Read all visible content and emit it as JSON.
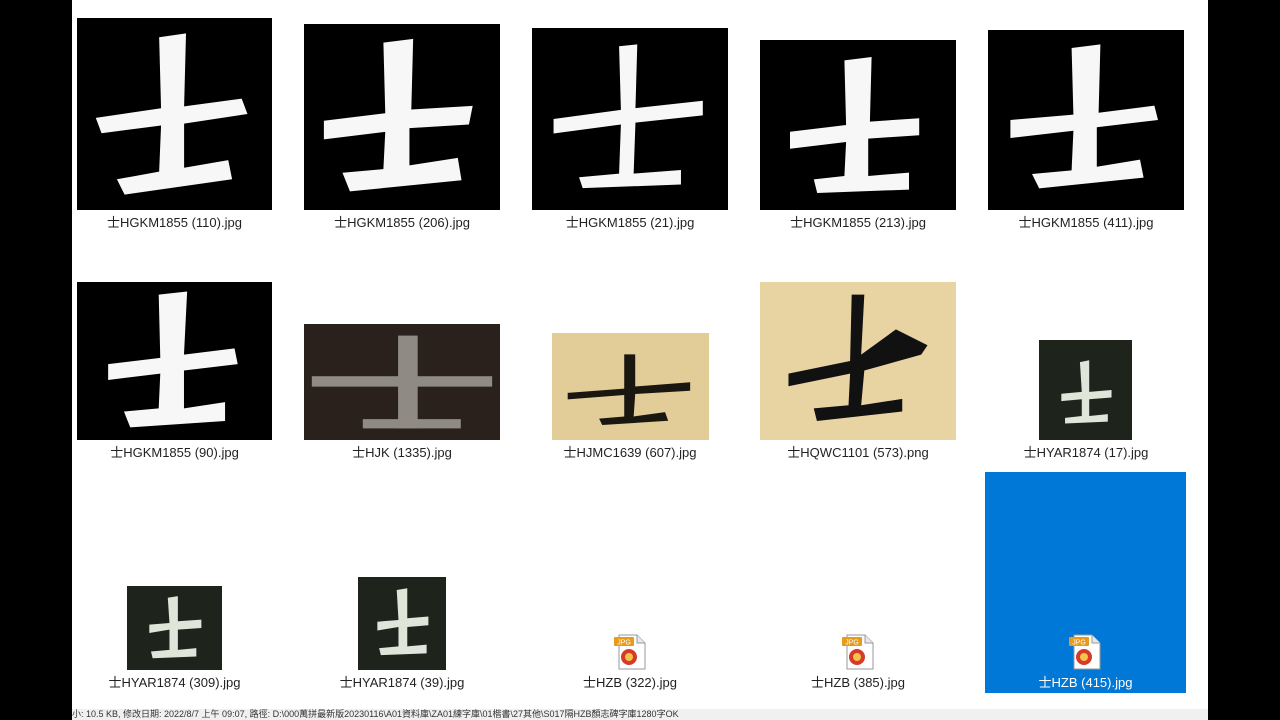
{
  "files": [
    {
      "name": "士HGKM1855 (110).jpg"
    },
    {
      "name": "士HGKM1855 (206).jpg"
    },
    {
      "name": "士HGKM1855 (21).jpg"
    },
    {
      "name": "士HGKM1855 (213).jpg"
    },
    {
      "name": "士HGKM1855 (411).jpg"
    },
    {
      "name": "士HGKM1855 (90).jpg"
    },
    {
      "name": "士HJK (1335).jpg"
    },
    {
      "name": "士HJMC1639 (607).jpg"
    },
    {
      "name": "士HQWC1101 (573).png"
    },
    {
      "name": "士HYAR1874 (17).jpg"
    },
    {
      "name": "士HYAR1874 (309).jpg"
    },
    {
      "name": "士HYAR1874 (39).jpg"
    },
    {
      "name": "士HZB (322).jpg"
    },
    {
      "name": "士HZB (385).jpg"
    },
    {
      "name": "士HZB (415).jpg",
      "selected": true
    }
  ],
  "icons": {
    "jpg_badge": "JPG",
    "generic_file": "jpg-file-icon"
  },
  "colors": {
    "selection": "#0078d7",
    "thumb_dark": "#000000",
    "paper": "#e8d3a2"
  },
  "status_text": "小: 10.5 KB, 修改日期: 2022/8/7 上午 09:07, 路徑: D:\\000萬拼最新版20230116\\A01資料庫\\ZA01練字庫\\01楷書\\27其他\\S017隔HZB顏志碑字庫1280字OK"
}
